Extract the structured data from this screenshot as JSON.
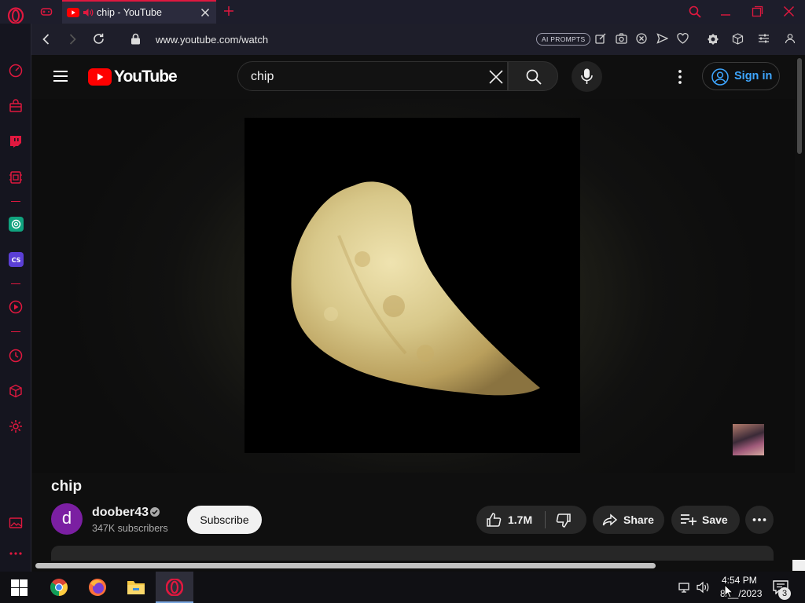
{
  "browser": {
    "tab_title": "chip - YouTube",
    "url": "www.youtube.com/watch",
    "ai_prompts_label": "AI PROMPTS",
    "icons": [
      "opera-logo-icon",
      "gamepad-icon",
      "youtube-icon",
      "speaker-icon",
      "close-icon",
      "plus-icon",
      "search-icon",
      "minimize-icon",
      "restore-icon",
      "close-window-icon",
      "back-icon",
      "forward-icon",
      "reload-icon",
      "lock-icon",
      "edit-icon",
      "camera-icon",
      "close-circle-icon",
      "send-icon",
      "heart-icon",
      "vpn-icon",
      "cube-icon",
      "sliders-icon",
      "user-icon"
    ]
  },
  "sidebar": {
    "items": [
      "speed-dial-icon",
      "shopping-icon",
      "twitch-icon",
      "extension-icon",
      "chatgpt-icon",
      "chatsonic-icon",
      "player-icon",
      "history-icon",
      "crypto-wallet-icon",
      "settings-icon",
      "gallery-icon",
      "more-icon"
    ]
  },
  "youtube": {
    "logo_text": "YouTube",
    "search_value": "chip",
    "signin_label": "Sign in",
    "video": {
      "title": "chip"
    },
    "channel": {
      "name": "doober43",
      "avatar_letter": "d",
      "subscribers": "347K subscribers",
      "avatar_color": "#7b1fa2"
    },
    "subscribe_label": "Subscribe",
    "like_count": "1.7M",
    "share_label": "Share",
    "save_label": "Save"
  },
  "taskbar": {
    "apps": [
      "windows-start-icon",
      "chrome-icon",
      "firefox-icon",
      "file-explorer-icon",
      "opera-icon"
    ],
    "time": "4:54 PM",
    "date": "8/__/2023",
    "notification_count": "3"
  },
  "colors": {
    "opera_red": "#e0183f",
    "yt_red": "#ff0000",
    "link_blue": "#3ea6ff"
  }
}
